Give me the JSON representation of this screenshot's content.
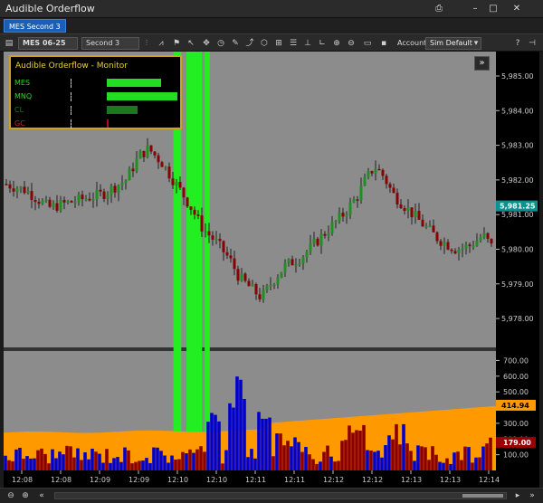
{
  "window": {
    "title": "Audible Orderflow"
  },
  "tabs": [
    {
      "label": "MES Second 3"
    }
  ],
  "toolbar": {
    "instrument": "MES 06-25",
    "interval": "Second 3",
    "account_label": "Account:",
    "account_value": "Sim Default"
  },
  "monitor": {
    "title": "Audible Orderflow - Monitor",
    "rows": [
      {
        "label": "MES",
        "color": "#22dd22",
        "level": 0.75
      },
      {
        "label": "MNQ",
        "color": "#22dd22",
        "level": 0.98
      },
      {
        "label": "CL",
        "color": "#1a7a1a",
        "level": 0.42
      },
      {
        "label": "GC",
        "color": "#aa1111",
        "level": 0.03
      }
    ]
  },
  "chart_data": [
    {
      "type": "candlestick",
      "title": "",
      "y_ticks": [
        "5,985.00",
        "5,984.00",
        "5,983.00",
        "5,982.00",
        "5,981.00",
        "5,980.00",
        "5,979.00",
        "5,978.00"
      ],
      "ylim": [
        5977.6,
        5985.3
      ],
      "last_price": "5,981.25",
      "highlight_zones": [
        {
          "start": "12:09:57",
          "end": "12:10:03"
        },
        {
          "start": "12:10:07",
          "end": "12:10:19"
        },
        {
          "start": "12:10:21",
          "end": "12:10:25"
        }
      ],
      "colors": {
        "up": "#1f8f1f",
        "down": "#8a0000",
        "background": "#8c8c8c",
        "highlight": "#22ee22"
      }
    },
    {
      "type": "bar",
      "title": "",
      "y_ticks": [
        "700.00",
        "600.00",
        "500.00",
        "400.00",
        "300.00",
        "200.00",
        "100.00"
      ],
      "ylim": [
        0,
        760
      ],
      "average_label": "414.94",
      "current_label": "179.00",
      "x_ticks": [
        "12:08",
        "12:08",
        "12:09",
        "12:09",
        "12:10",
        "12:10",
        "12:11",
        "12:11",
        "12:12",
        "12:12",
        "12:13",
        "12:13",
        "12:14"
      ],
      "colors": {
        "buy": "#0000cc",
        "sell": "#8b0000",
        "average": "#ff9900",
        "background": "#8c8c8c"
      }
    }
  ]
}
